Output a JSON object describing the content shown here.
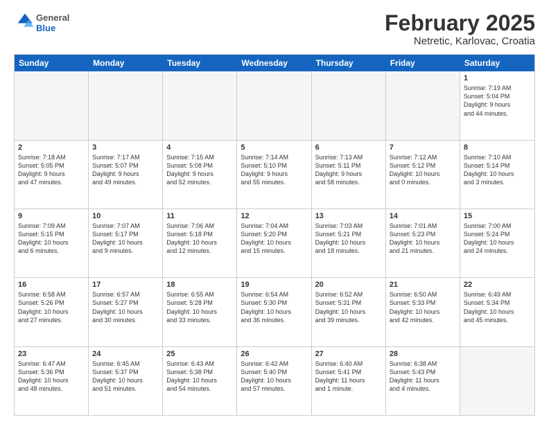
{
  "logo": {
    "general": "General",
    "blue": "Blue"
  },
  "header": {
    "month_year": "February 2025",
    "location": "Netretic, Karlovac, Croatia"
  },
  "days_of_week": [
    "Sunday",
    "Monday",
    "Tuesday",
    "Wednesday",
    "Thursday",
    "Friday",
    "Saturday"
  ],
  "weeks": [
    [
      {
        "day": "",
        "info": "",
        "empty": true
      },
      {
        "day": "",
        "info": "",
        "empty": true
      },
      {
        "day": "",
        "info": "",
        "empty": true
      },
      {
        "day": "",
        "info": "",
        "empty": true
      },
      {
        "day": "",
        "info": "",
        "empty": true
      },
      {
        "day": "",
        "info": "",
        "empty": true
      },
      {
        "day": "1",
        "info": "Sunrise: 7:19 AM\nSunset: 5:04 PM\nDaylight: 9 hours\nand 44 minutes.",
        "empty": false
      }
    ],
    [
      {
        "day": "2",
        "info": "Sunrise: 7:18 AM\nSunset: 5:05 PM\nDaylight: 9 hours\nand 47 minutes.",
        "empty": false
      },
      {
        "day": "3",
        "info": "Sunrise: 7:17 AM\nSunset: 5:07 PM\nDaylight: 9 hours\nand 49 minutes.",
        "empty": false
      },
      {
        "day": "4",
        "info": "Sunrise: 7:15 AM\nSunset: 5:08 PM\nDaylight: 9 hours\nand 52 minutes.",
        "empty": false
      },
      {
        "day": "5",
        "info": "Sunrise: 7:14 AM\nSunset: 5:10 PM\nDaylight: 9 hours\nand 55 minutes.",
        "empty": false
      },
      {
        "day": "6",
        "info": "Sunrise: 7:13 AM\nSunset: 5:11 PM\nDaylight: 9 hours\nand 58 minutes.",
        "empty": false
      },
      {
        "day": "7",
        "info": "Sunrise: 7:12 AM\nSunset: 5:12 PM\nDaylight: 10 hours\nand 0 minutes.",
        "empty": false
      },
      {
        "day": "8",
        "info": "Sunrise: 7:10 AM\nSunset: 5:14 PM\nDaylight: 10 hours\nand 3 minutes.",
        "empty": false
      }
    ],
    [
      {
        "day": "9",
        "info": "Sunrise: 7:09 AM\nSunset: 5:15 PM\nDaylight: 10 hours\nand 6 minutes.",
        "empty": false
      },
      {
        "day": "10",
        "info": "Sunrise: 7:07 AM\nSunset: 5:17 PM\nDaylight: 10 hours\nand 9 minutes.",
        "empty": false
      },
      {
        "day": "11",
        "info": "Sunrise: 7:06 AM\nSunset: 5:18 PM\nDaylight: 10 hours\nand 12 minutes.",
        "empty": false
      },
      {
        "day": "12",
        "info": "Sunrise: 7:04 AM\nSunset: 5:20 PM\nDaylight: 10 hours\nand 15 minutes.",
        "empty": false
      },
      {
        "day": "13",
        "info": "Sunrise: 7:03 AM\nSunset: 5:21 PM\nDaylight: 10 hours\nand 18 minutes.",
        "empty": false
      },
      {
        "day": "14",
        "info": "Sunrise: 7:01 AM\nSunset: 5:23 PM\nDaylight: 10 hours\nand 21 minutes.",
        "empty": false
      },
      {
        "day": "15",
        "info": "Sunrise: 7:00 AM\nSunset: 5:24 PM\nDaylight: 10 hours\nand 24 minutes.",
        "empty": false
      }
    ],
    [
      {
        "day": "16",
        "info": "Sunrise: 6:58 AM\nSunset: 5:26 PM\nDaylight: 10 hours\nand 27 minutes.",
        "empty": false
      },
      {
        "day": "17",
        "info": "Sunrise: 6:57 AM\nSunset: 5:27 PM\nDaylight: 10 hours\nand 30 minutes.",
        "empty": false
      },
      {
        "day": "18",
        "info": "Sunrise: 6:55 AM\nSunset: 5:28 PM\nDaylight: 10 hours\nand 33 minutes.",
        "empty": false
      },
      {
        "day": "19",
        "info": "Sunrise: 6:54 AM\nSunset: 5:30 PM\nDaylight: 10 hours\nand 36 minutes.",
        "empty": false
      },
      {
        "day": "20",
        "info": "Sunrise: 6:52 AM\nSunset: 5:31 PM\nDaylight: 10 hours\nand 39 minutes.",
        "empty": false
      },
      {
        "day": "21",
        "info": "Sunrise: 6:50 AM\nSunset: 5:33 PM\nDaylight: 10 hours\nand 42 minutes.",
        "empty": false
      },
      {
        "day": "22",
        "info": "Sunrise: 6:49 AM\nSunset: 5:34 PM\nDaylight: 10 hours\nand 45 minutes.",
        "empty": false
      }
    ],
    [
      {
        "day": "23",
        "info": "Sunrise: 6:47 AM\nSunset: 5:36 PM\nDaylight: 10 hours\nand 48 minutes.",
        "empty": false
      },
      {
        "day": "24",
        "info": "Sunrise: 6:45 AM\nSunset: 5:37 PM\nDaylight: 10 hours\nand 51 minutes.",
        "empty": false
      },
      {
        "day": "25",
        "info": "Sunrise: 6:43 AM\nSunset: 5:38 PM\nDaylight: 10 hours\nand 54 minutes.",
        "empty": false
      },
      {
        "day": "26",
        "info": "Sunrise: 6:42 AM\nSunset: 5:40 PM\nDaylight: 10 hours\nand 57 minutes.",
        "empty": false
      },
      {
        "day": "27",
        "info": "Sunrise: 6:40 AM\nSunset: 5:41 PM\nDaylight: 11 hours\nand 1 minute.",
        "empty": false
      },
      {
        "day": "28",
        "info": "Sunrise: 6:38 AM\nSunset: 5:43 PM\nDaylight: 11 hours\nand 4 minutes.",
        "empty": false
      },
      {
        "day": "",
        "info": "",
        "empty": true
      }
    ]
  ]
}
